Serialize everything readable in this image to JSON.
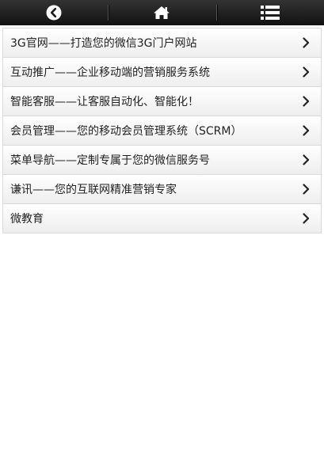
{
  "topbar": {
    "icons": [
      "back-circle-icon",
      "home-icon",
      "list-menu-icon"
    ]
  },
  "menu": {
    "items": [
      {
        "label": "3G官网——打造您的微信3G门户网站"
      },
      {
        "label": "互动推广——企业移动端的营销服务系统"
      },
      {
        "label": "智能客服——让客服自动化、智能化！"
      },
      {
        "label": "会员管理——您的移动会员管理系统（SCRM）"
      },
      {
        "label": "菜单导航——定制专属于您的微信服务号"
      },
      {
        "label": "谦讯——您的互联网精准营销专家"
      },
      {
        "label": "微教育"
      }
    ]
  },
  "colors": {
    "topbar": "#1a1a1a",
    "item_text": "#222222",
    "border": "#d9d9d9"
  }
}
